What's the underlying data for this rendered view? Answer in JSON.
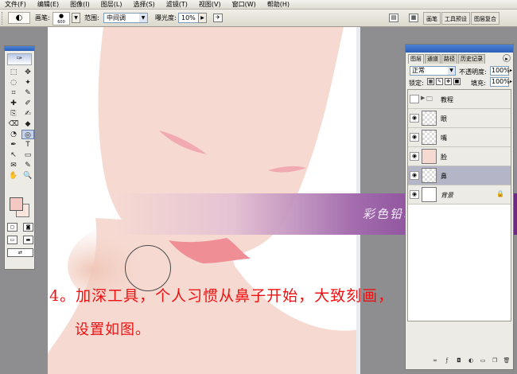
{
  "menu": [
    "文件(F)",
    "编辑(E)",
    "图像(I)",
    "图层(L)",
    "选择(S)",
    "滤镜(T)",
    "视图(V)",
    "窗口(W)",
    "帮助(H)"
  ],
  "options": {
    "tool_glyph": "◐",
    "brush_label": "画笔:",
    "brush_size": "600",
    "range_label": "范围:",
    "range_value": "中间调",
    "exposure_label": "曝光度:",
    "exposure_value": "10%",
    "wells": [
      "画笔",
      "工具预设",
      "图层复合"
    ]
  },
  "toolbox": {
    "tools": [
      "⬚",
      "✥",
      "◌",
      "✦",
      "⌗",
      "✎",
      "✚",
      "✐",
      "⎘",
      "✍",
      "⌫",
      "◆",
      "◔",
      "◎",
      "✒",
      "T",
      "↖",
      "▭",
      "✉",
      "✎",
      "✋",
      "🔍"
    ]
  },
  "canvas": {
    "banner_text": "彩色铅笔-靖 原创教程",
    "caption_line1": "4。加深工具，个人习惯从鼻子开始，大致刻画，",
    "caption_line2": "设置如图。"
  },
  "layers_panel": {
    "tabs": [
      "图层",
      "通道",
      "路径",
      "历史记录"
    ],
    "blend_mode": "正常",
    "opacity_label": "不透明度:",
    "opacity_value": "100%",
    "lock_label": "锁定:",
    "fill_label": "填充:",
    "fill_value": "100%",
    "layers": [
      {
        "name": "教程",
        "type": "group",
        "selected": false
      },
      {
        "name": "眼",
        "type": "layer",
        "selected": false
      },
      {
        "name": "嘴",
        "type": "layer",
        "selected": false
      },
      {
        "name": "脸",
        "type": "layer",
        "selected": false
      },
      {
        "name": "鼻",
        "type": "layer",
        "selected": true
      },
      {
        "name": "背景",
        "type": "background",
        "selected": false
      }
    ],
    "footer_icons": [
      "link-icon",
      "fx-icon",
      "mask-icon",
      "adjustment-icon",
      "folder-icon",
      "new-layer-icon",
      "trash-icon"
    ]
  },
  "colors": {
    "foreground": "#f5c9c2",
    "background": "#fae5dc",
    "skin": "#f6dad2",
    "lips": "#ef8e95",
    "caption": "#ee1111"
  }
}
